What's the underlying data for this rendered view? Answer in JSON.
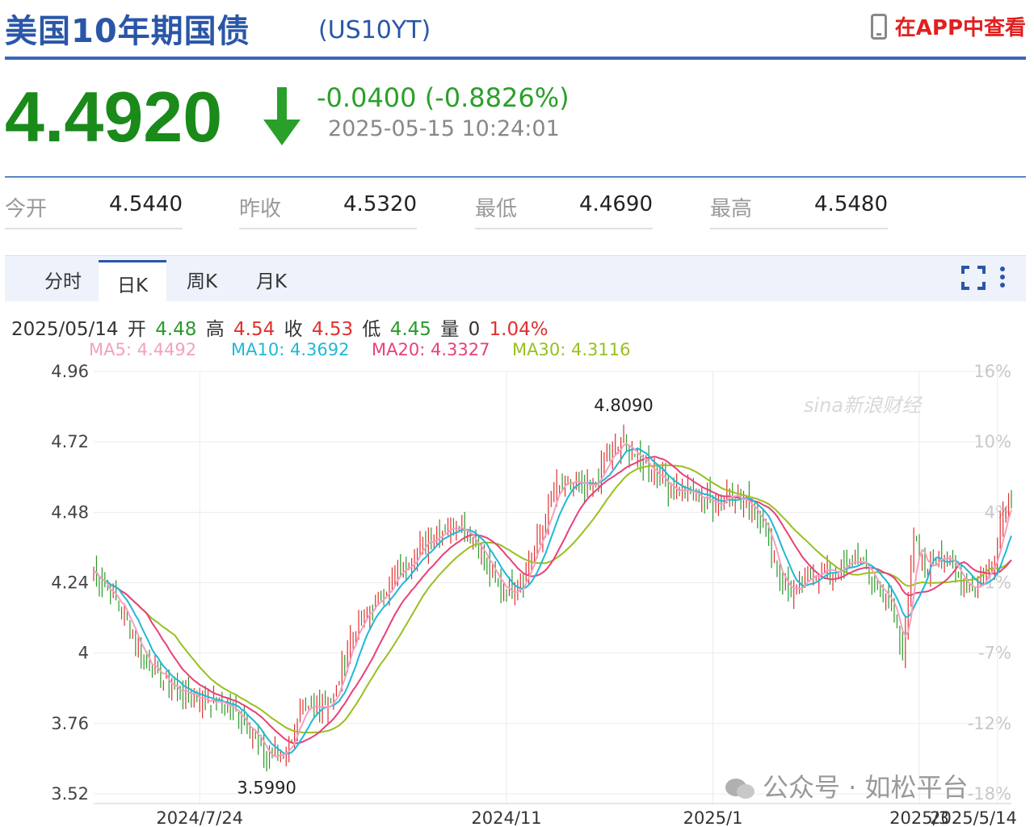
{
  "header": {
    "title": "美国10年期国债",
    "code": "(US10YT)",
    "app_link": "在APP中查看"
  },
  "quote": {
    "price": "4.4920",
    "change": "-0.0400 (-0.8826%)",
    "timestamp": "2025-05-15 10:24:01",
    "direction": "down",
    "down_color": "#2aa02a"
  },
  "stats": [
    {
      "label": "今开",
      "value": "4.5440"
    },
    {
      "label": "昨收",
      "value": "4.5320"
    },
    {
      "label": "最低",
      "value": "4.4690"
    },
    {
      "label": "最高",
      "value": "4.5480"
    }
  ],
  "tabs": [
    {
      "label": "分时",
      "active": false
    },
    {
      "label": "日K",
      "active": true
    },
    {
      "label": "周K",
      "active": false
    },
    {
      "label": "月K",
      "active": false
    }
  ],
  "info_bar": {
    "date": "2025/05/14",
    "open_label": "开",
    "open": "4.48",
    "high_label": "高",
    "high": "4.54",
    "close_label": "收",
    "close": "4.53",
    "low_label": "低",
    "low": "4.45",
    "vol_label": "量",
    "vol": "0",
    "pct": "1.04%"
  },
  "ma_legend": [
    {
      "text": "MA5: 4.4492",
      "color": "#f4a0c0"
    },
    {
      "text": "MA10: 4.3692",
      "color": "#20b8d8"
    },
    {
      "text": "MA20: 4.3327",
      "color": "#e8407a"
    },
    {
      "text": "MA30: 4.3116",
      "color": "#98c020"
    }
  ],
  "watermark": "公众号 · 如松平台",
  "brand_watermark": "sina新浪财经",
  "chart_data": {
    "type": "candlestick",
    "ylim": [
      3.52,
      4.96
    ],
    "y_ticks": [
      "4.96",
      "4.72",
      "4.48",
      "4.24",
      "4",
      "3.76",
      "3.52"
    ],
    "y_right_ticks": [
      "16%",
      "10%",
      "4%",
      "-1%",
      "-7%",
      "-12%",
      "-18%"
    ],
    "x_labels": [
      "2024/7/24",
      "2024/11",
      "2025/1",
      "2025/3",
      "2025/5/14"
    ],
    "annotations": [
      {
        "text": "4.8090",
        "value": 4.809
      },
      {
        "text": "3.5990",
        "value": 3.599
      }
    ],
    "up_color": "#e03030",
    "down_color": "#2a9a2a",
    "series_colors": {
      "MA5": "#f4a0c0",
      "MA10": "#20b8d8",
      "MA20": "#e8407a",
      "MA30": "#98c020"
    },
    "anchors": [
      [
        0,
        4.28
      ],
      [
        10,
        4.15
      ],
      [
        18,
        3.98
      ],
      [
        28,
        3.88
      ],
      [
        38,
        3.85
      ],
      [
        48,
        3.82
      ],
      [
        56,
        3.75
      ],
      [
        62,
        3.64
      ],
      [
        68,
        3.66
      ],
      [
        74,
        3.78
      ],
      [
        80,
        3.82
      ],
      [
        86,
        3.84
      ],
      [
        92,
        4.05
      ],
      [
        98,
        4.14
      ],
      [
        106,
        4.23
      ],
      [
        114,
        4.33
      ],
      [
        120,
        4.39
      ],
      [
        126,
        4.43
      ],
      [
        132,
        4.44
      ],
      [
        138,
        4.36
      ],
      [
        144,
        4.24
      ],
      [
        150,
        4.21
      ],
      [
        154,
        4.26
      ],
      [
        160,
        4.4
      ],
      [
        166,
        4.56
      ],
      [
        172,
        4.58
      ],
      [
        178,
        4.55
      ],
      [
        184,
        4.66
      ],
      [
        190,
        4.72
      ],
      [
        194,
        4.67
      ],
      [
        200,
        4.63
      ],
      [
        206,
        4.57
      ],
      [
        212,
        4.55
      ],
      [
        218,
        4.53
      ],
      [
        224,
        4.51
      ],
      [
        228,
        4.56
      ],
      [
        232,
        4.52
      ],
      [
        236,
        4.5
      ],
      [
        240,
        4.45
      ],
      [
        246,
        4.25
      ],
      [
        252,
        4.2
      ],
      [
        258,
        4.28
      ],
      [
        266,
        4.28
      ],
      [
        274,
        4.32
      ],
      [
        280,
        4.24
      ],
      [
        286,
        4.16
      ],
      [
        290,
        4.0
      ],
      [
        294,
        4.39
      ],
      [
        298,
        4.28
      ],
      [
        304,
        4.35
      ],
      [
        310,
        4.26
      ],
      [
        316,
        4.22
      ],
      [
        322,
        4.3
      ],
      [
        326,
        4.48
      ],
      [
        328,
        4.53
      ]
    ]
  }
}
